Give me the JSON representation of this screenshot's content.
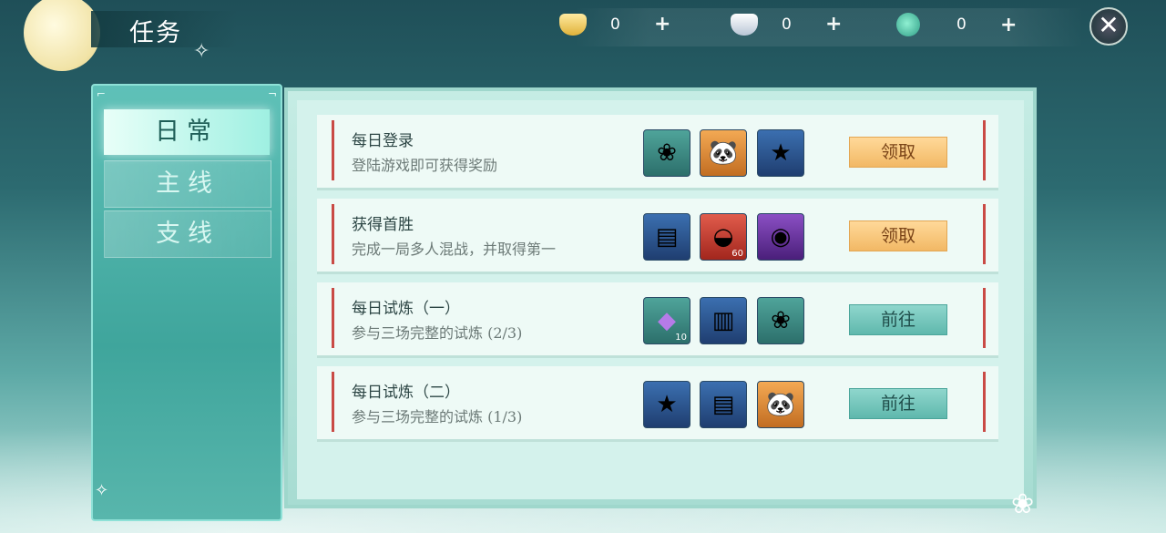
{
  "header": {
    "title": "任务",
    "currencies": [
      {
        "icon": "gold-ingot-icon",
        "value": "0",
        "add": "+"
      },
      {
        "icon": "silver-ingot-icon",
        "value": "0",
        "add": "+"
      },
      {
        "icon": "jade-coin-icon",
        "value": "0",
        "add": "+"
      }
    ],
    "close": "✕"
  },
  "tabs": [
    {
      "label": "日常",
      "active": true
    },
    {
      "label": "主线",
      "active": false
    },
    {
      "label": "支线",
      "active": false
    }
  ],
  "tasks": [
    {
      "name": "每日登录",
      "desc": "登陆游戏即可获得奖励",
      "rewards": [
        {
          "icon": "lotus-icon",
          "count": ""
        },
        {
          "icon": "panda-icon",
          "count": ""
        },
        {
          "icon": "star-dart-icon",
          "count": ""
        }
      ],
      "button": "领取",
      "button_type": "claim"
    },
    {
      "name": "获得首胜",
      "desc": "完成一局多人混战，并取得第一",
      "rewards": [
        {
          "icon": "skill-book-icon",
          "count": ""
        },
        {
          "icon": "gold-ingot-icon",
          "count": "60"
        },
        {
          "icon": "crystal-ball-icon",
          "count": ""
        }
      ],
      "button": "领取",
      "button_type": "claim"
    },
    {
      "name": "每日试炼（一）",
      "desc": "参与三场完整的试炼 (2/3)",
      "rewards": [
        {
          "icon": "purple-crystal-icon",
          "count": "10"
        },
        {
          "icon": "scroll-icon",
          "count": ""
        },
        {
          "icon": "lotus-icon",
          "count": ""
        }
      ],
      "button": "前往",
      "button_type": "go"
    },
    {
      "name": "每日试炼（二）",
      "desc": "参与三场完整的试炼 (1/3)",
      "rewards": [
        {
          "icon": "star-dart-icon",
          "count": ""
        },
        {
          "icon": "skill-book-icon",
          "count": ""
        },
        {
          "icon": "panda-icon",
          "count": ""
        }
      ],
      "button": "前往",
      "button_type": "go"
    }
  ]
}
